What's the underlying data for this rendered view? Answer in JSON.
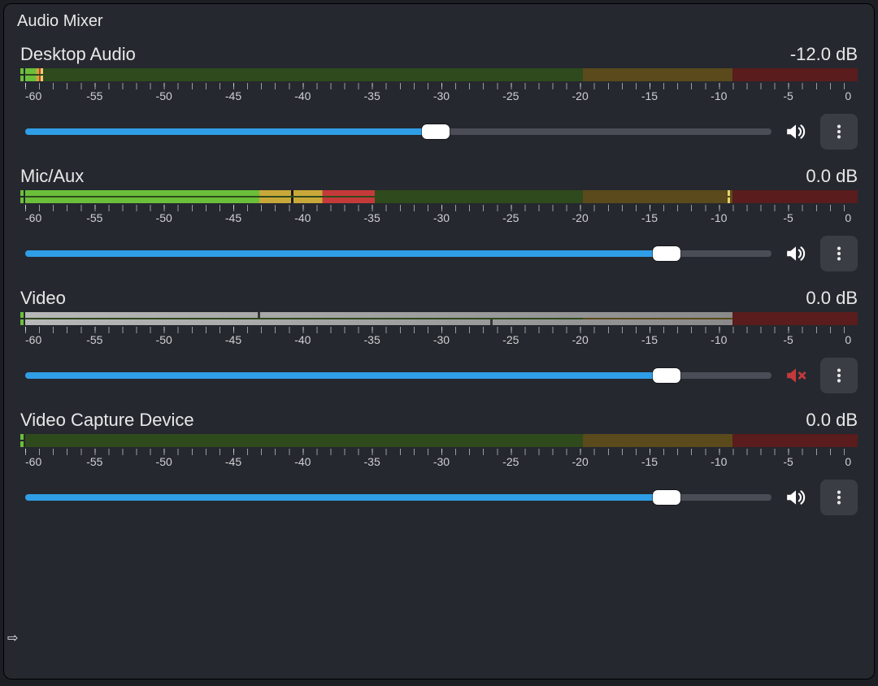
{
  "panel_title": "Audio Mixer",
  "ruler_labels": [
    "-60",
    "-55",
    "-50",
    "-45",
    "-40",
    "-35",
    "-30",
    "-25",
    "-20",
    "-15",
    "-10",
    "-5",
    "0"
  ],
  "zone_split_pct": {
    "green_end": 67,
    "yellow_end": 85
  },
  "channels": [
    {
      "id": "desktop-audio",
      "label": "Desktop Audio",
      "db_text": "-12.0 dB",
      "meter_style": "color",
      "bar_top_pct": 2,
      "bar_bot_pct": 2,
      "peak_top_pct": 2,
      "peak_bot_pct": 2,
      "slider_pct": 55,
      "muted": false
    },
    {
      "id": "mic-aux",
      "label": "Mic/Aux",
      "db_text": "0.0 dB",
      "meter_style": "color",
      "bar_top_pct": 42,
      "bar_bot_pct": 42,
      "peak_top_pct": 84.5,
      "peak_bot_pct": 84.5,
      "peak2_top_pct": 32,
      "peak2_bot_pct": 32,
      "slider_pct": 86,
      "muted": false
    },
    {
      "id": "video",
      "label": "Video",
      "db_text": "0.0 dB",
      "meter_style": "neutral",
      "bar_top_pct": 85,
      "bar_bot_pct": 85,
      "peak_top_pct": 28,
      "peak_bot_pct": 56,
      "slider_pct": 86,
      "muted": true
    },
    {
      "id": "video-capture",
      "label": "Video Capture Device",
      "db_text": "0.0 dB",
      "meter_style": "color",
      "bar_top_pct": 0,
      "bar_bot_pct": 0,
      "peak_top_pct": 0,
      "peak_bot_pct": 0,
      "slider_pct": 86,
      "muted": false
    }
  ]
}
